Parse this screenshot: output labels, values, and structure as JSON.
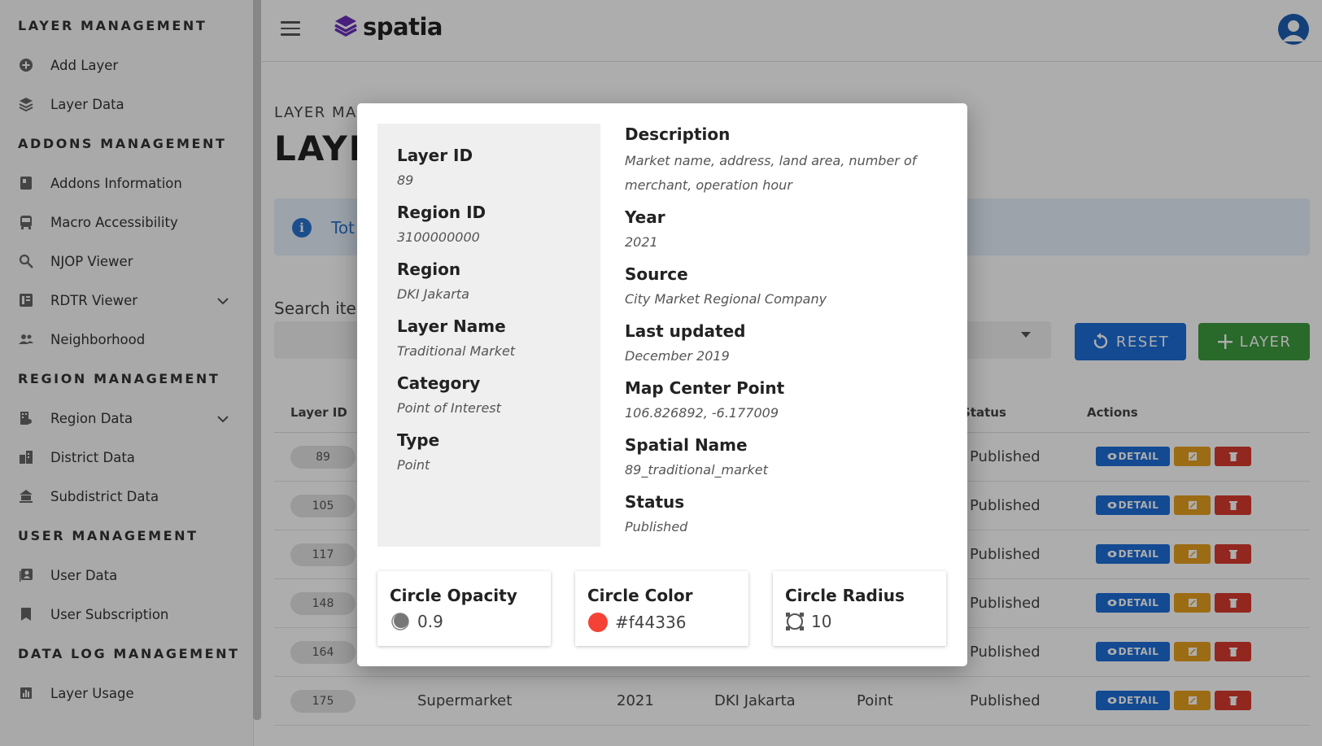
{
  "sidebar": {
    "sections": [
      {
        "title": "LAYER MANAGEMENT"
      },
      {
        "title": "ADDONS MANAGEMENT"
      },
      {
        "title": "REGION MANAGEMENT"
      },
      {
        "title": "USER MANAGEMENT"
      },
      {
        "title": "DATA LOG MANAGEMENT"
      }
    ],
    "items": [
      {
        "label": "Add Layer",
        "icon": "add-circle-icon"
      },
      {
        "label": "Layer Data",
        "icon": "layers-icon"
      },
      {
        "label": "Addons Information",
        "icon": "info-doc-icon"
      },
      {
        "label": "Macro Accessibility",
        "icon": "bus-icon"
      },
      {
        "label": "NJOP Viewer",
        "icon": "search-map-icon"
      },
      {
        "label": "RDTR Viewer",
        "icon": "map-book-icon"
      },
      {
        "label": "Neighborhood",
        "icon": "people-icon"
      },
      {
        "label": "Region Data",
        "icon": "region-icon"
      },
      {
        "label": "District Data",
        "icon": "district-icon"
      },
      {
        "label": "Subdistrict Data",
        "icon": "subdistrict-icon"
      },
      {
        "label": "User Data",
        "icon": "user-data-icon"
      },
      {
        "label": "User Subscription",
        "icon": "bookmark-icon"
      },
      {
        "label": "Layer Usage",
        "icon": "bar-chart-icon"
      }
    ]
  },
  "header": {
    "brand": "spatia"
  },
  "page": {
    "crumb": "LAYER MA",
    "title": "LAYE",
    "info_text": "Tot",
    "search_label": "Search ite",
    "reset_label": "RESET",
    "add_label": "LAYER"
  },
  "table": {
    "headers": {
      "id": "Layer ID",
      "status": "Status",
      "actions": "Actions"
    },
    "rows": [
      {
        "id": "89",
        "name": "",
        "year": "",
        "region": "",
        "type": "",
        "status": "Published"
      },
      {
        "id": "105",
        "name": "",
        "year": "",
        "region": "",
        "type": "",
        "status": "Published"
      },
      {
        "id": "117",
        "name": "",
        "year": "",
        "region": "",
        "type": "",
        "status": "Published"
      },
      {
        "id": "148",
        "name": "",
        "year": "",
        "region": "",
        "type": "",
        "status": "Published"
      },
      {
        "id": "164",
        "name": "",
        "year": "",
        "region": "",
        "type": "",
        "status": "Published"
      },
      {
        "id": "175",
        "name": "Supermarket",
        "year": "2021",
        "region": "DKI Jakarta",
        "type": "Point",
        "status": "Published"
      }
    ],
    "detail_label": "DETAIL"
  },
  "modal": {
    "left": [
      {
        "label": "Layer ID",
        "value": "89"
      },
      {
        "label": "Region ID",
        "value": "3100000000"
      },
      {
        "label": "Region",
        "value": "DKI Jakarta"
      },
      {
        "label": "Layer Name",
        "value": "Traditional Market"
      },
      {
        "label": "Category",
        "value": "Point of Interest"
      },
      {
        "label": "Type",
        "value": "Point"
      }
    ],
    "description_label": "Description",
    "description_value": "Market name, address, land area, number of merchant, operation hour",
    "right": [
      {
        "label": "Year",
        "value": "2021"
      },
      {
        "label": "Source",
        "value": "City Market Regional Company"
      },
      {
        "label": "Last updated",
        "value": "December 2019"
      },
      {
        "label": "Map Center Point",
        "value": "106.826892, -6.177009"
      },
      {
        "label": "Spatial Name",
        "value": "89_traditional_market"
      },
      {
        "label": "Status",
        "value": "Published"
      }
    ],
    "cards": [
      {
        "title": "Circle Opacity",
        "value": "0.9",
        "icon": "opacity-icon"
      },
      {
        "title": "Circle Color",
        "value": "#f44336",
        "icon": "color-swatch-icon"
      },
      {
        "title": "Circle Radius",
        "value": "10",
        "icon": "radius-icon"
      }
    ]
  },
  "colors": {
    "primary_blue": "#1d6ed8",
    "green": "#3d9b3f",
    "orange": "#e6a020",
    "red": "#d83a2e",
    "circle_color": "#f44336",
    "brand_purple": "#6a2fb8"
  }
}
